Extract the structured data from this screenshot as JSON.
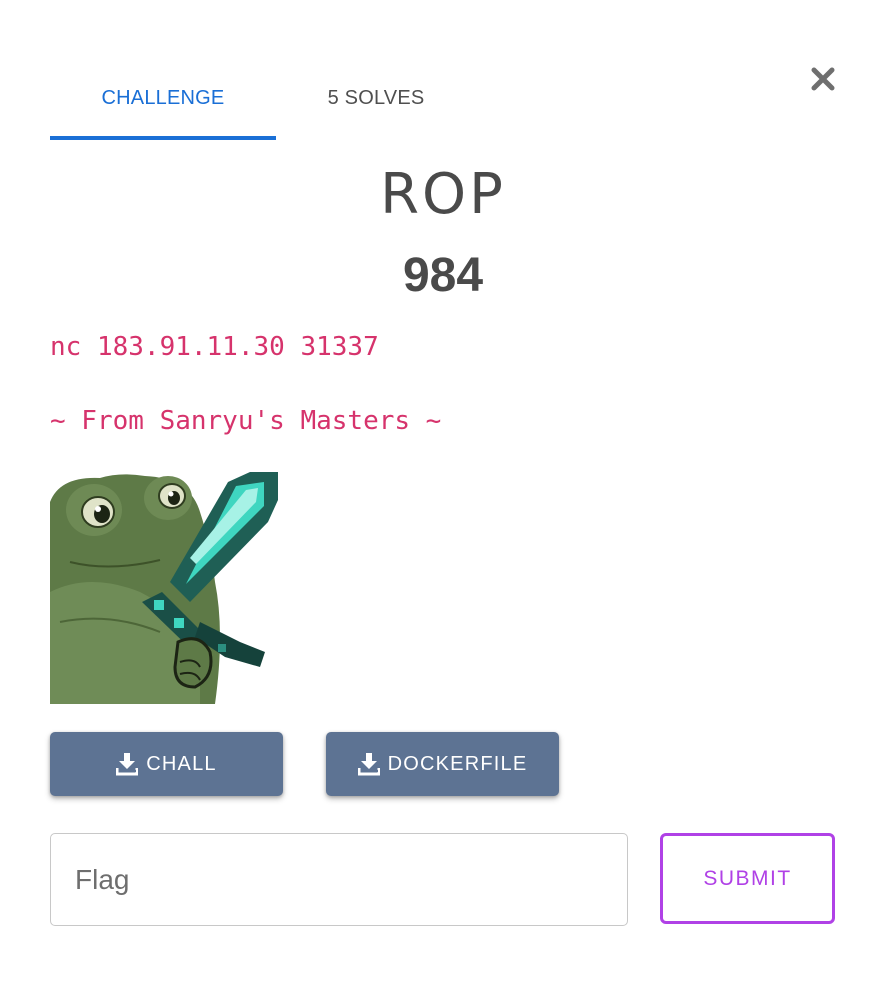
{
  "tabs": [
    {
      "label": "CHALLENGE",
      "active": true
    },
    {
      "label": "5 SOLVES",
      "active": false
    }
  ],
  "challenge": {
    "title": "ROP",
    "points": "984",
    "description": {
      "connection": "nc 183.91.11.30 31337",
      "tagline": "~ From Sanryu's Masters ~"
    },
    "image": {
      "depicts": "frog holding a pixelated diamond sword"
    }
  },
  "downloads": [
    {
      "label": "CHALL",
      "icon": "download-icon"
    },
    {
      "label": "DOCKERFILE",
      "icon": "download-icon"
    }
  ],
  "flag_form": {
    "placeholder": "Flag",
    "value": "",
    "submit_label": "SUBMIT"
  },
  "colors": {
    "accent": "#1a6fd6",
    "description_text": "#d6336c",
    "download_button": "#5d7393",
    "submit": "#b041e6"
  }
}
